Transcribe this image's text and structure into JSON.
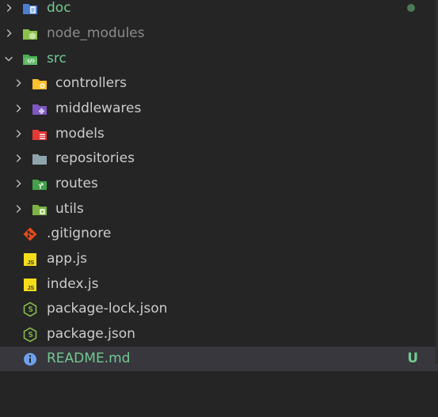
{
  "explorer": {
    "items": [
      {
        "label": "doc",
        "icon": "folder-doc-icon",
        "color": "#73c991"
      },
      {
        "label": "node_modules",
        "icon": "folder-node-icon",
        "color": "#8b8b8b"
      },
      {
        "label": "src",
        "icon": "folder-src-icon",
        "color": "#73c991"
      },
      {
        "label": "controllers",
        "icon": "folder-controllers-icon",
        "color": "#cccccc"
      },
      {
        "label": "middlewares",
        "icon": "folder-middleware-icon",
        "color": "#cccccc"
      },
      {
        "label": "models",
        "icon": "folder-models-icon",
        "color": "#cccccc"
      },
      {
        "label": "repositories",
        "icon": "folder-repositories-icon",
        "color": "#cccccc"
      },
      {
        "label": "routes",
        "icon": "folder-routes-icon",
        "color": "#cccccc"
      },
      {
        "label": "utils",
        "icon": "folder-utils-icon",
        "color": "#cccccc"
      },
      {
        "label": ".gitignore",
        "icon": "git-icon",
        "color": "#cccccc"
      },
      {
        "label": "app.js",
        "icon": "javascript-icon",
        "color": "#cccccc"
      },
      {
        "label": "index.js",
        "icon": "javascript-icon",
        "color": "#cccccc"
      },
      {
        "label": "package-lock.json",
        "icon": "nodejs-icon",
        "color": "#cccccc"
      },
      {
        "label": "package.json",
        "icon": "nodejs-icon",
        "color": "#cccccc"
      },
      {
        "label": "README.md",
        "icon": "info-icon",
        "color": "#73c991",
        "badge": "U"
      }
    ]
  },
  "js_icon_text": "JS"
}
